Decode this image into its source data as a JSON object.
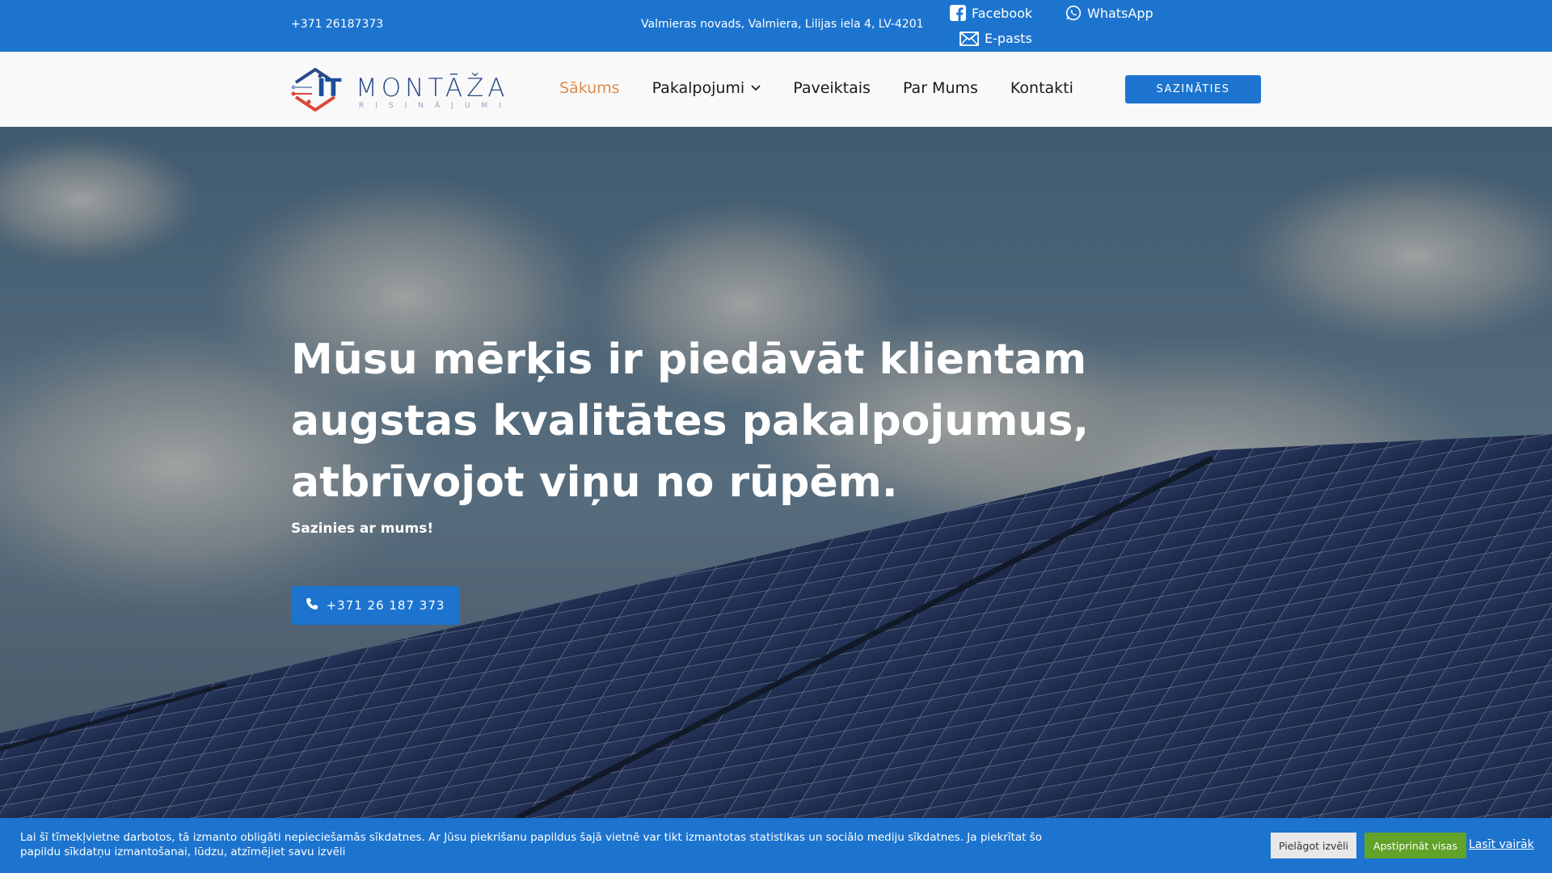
{
  "topbar": {
    "phone": "+371 26187373",
    "address": "Valmieras novads, Valmiera, Lilijas iela 4, LV-4201",
    "facebook_label": "Facebook",
    "whatsapp_label": "WhatsApp",
    "email_label": "E-pasts"
  },
  "header": {
    "logo": {
      "it": "IT",
      "name": "MONTĀŽA",
      "sub": "RISINĀJUMI"
    },
    "nav": [
      {
        "label": "Sākums",
        "active": true
      },
      {
        "label": "Pakalpojumi",
        "has_dropdown": true
      },
      {
        "label": "Paveiktais"
      },
      {
        "label": "Par Mums"
      },
      {
        "label": "Kontakti"
      }
    ],
    "cta_label": "SAZINĀTIES"
  },
  "hero": {
    "headline": "Mūsu mērķis ir piedāvāt klientam augstas kvalitātes pakalpojumus, atbrīvojot viņu no rūpēm.",
    "subline": "Sazinies ar mums!",
    "call_button_label": "+371 26 187 373"
  },
  "cookie_bar": {
    "text": "Lai šī tīmekļvietne darbotos, tā izmanto obligāti nepieciešamās sīkdatnes. Ar Jūsu piekrišanu papildus šajā vietnē var tikt izmantotas statistikas un sociālo mediju sīkdatnes. Ja piekrītat šo papildu sīkdatņu izmantošanai, lūdzu, atzīmējiet savu izvēli",
    "customize_label": "Pielāgot izvēli",
    "accept_label": "Apstiprināt visas",
    "read_more_label": "Lasīt vairāk"
  },
  "colors": {
    "primary": "#1c74cf",
    "nav_active": "#e08c4c",
    "accept_green": "#61a229"
  },
  "icons": {
    "facebook": "facebook-icon",
    "whatsapp": "whatsapp-icon",
    "email": "envelope-icon",
    "phone": "phone-icon",
    "dropdown": "chevron-down-icon"
  }
}
